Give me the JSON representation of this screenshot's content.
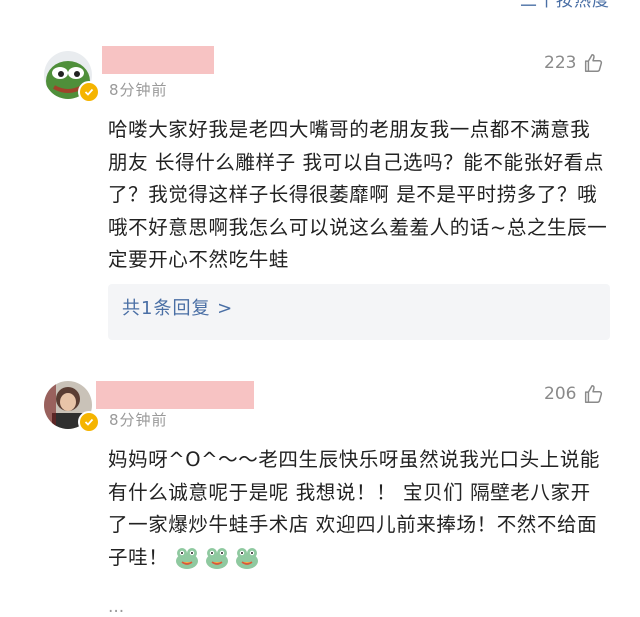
{
  "header": {
    "sort_label": "二十按热度"
  },
  "comments": [
    {
      "time": "8分钟前",
      "likes": "223",
      "text": "哈喽大家好我是老四大嘴哥的老朋友我一点都不满意我朋友 长得什么雕样子 我可以自己选吗？能不能张好看点了？我觉得这样子长得很萎靡啊 是不是平时捞多了？哦哦不好意思啊我怎么可以说这么羞羞人的话~总之生辰一定要开心不然吃牛蛙",
      "replies_label": "共1条回复 >"
    },
    {
      "time": "8分钟前",
      "likes": "206",
      "text": "妈妈呀^O^～～老四生辰快乐呀虽然说我光口头上说能有什么诚意呢于是呢 我想说！！ 宝贝们 隔壁老八家开了一家爆炒牛蛙手术店 欢迎四儿前来捧场！不然不给面子哇！"
    }
  ],
  "footer": {
    "peek_text": "..."
  },
  "colors": {
    "link": "#4a6fa5",
    "meta": "#9a9a9a",
    "mask": "#f6bcbc",
    "badge": "#f5b400"
  },
  "icons": [
    "thumbs-up-icon",
    "verified-badge-icon",
    "frog-emoji-icon"
  ]
}
